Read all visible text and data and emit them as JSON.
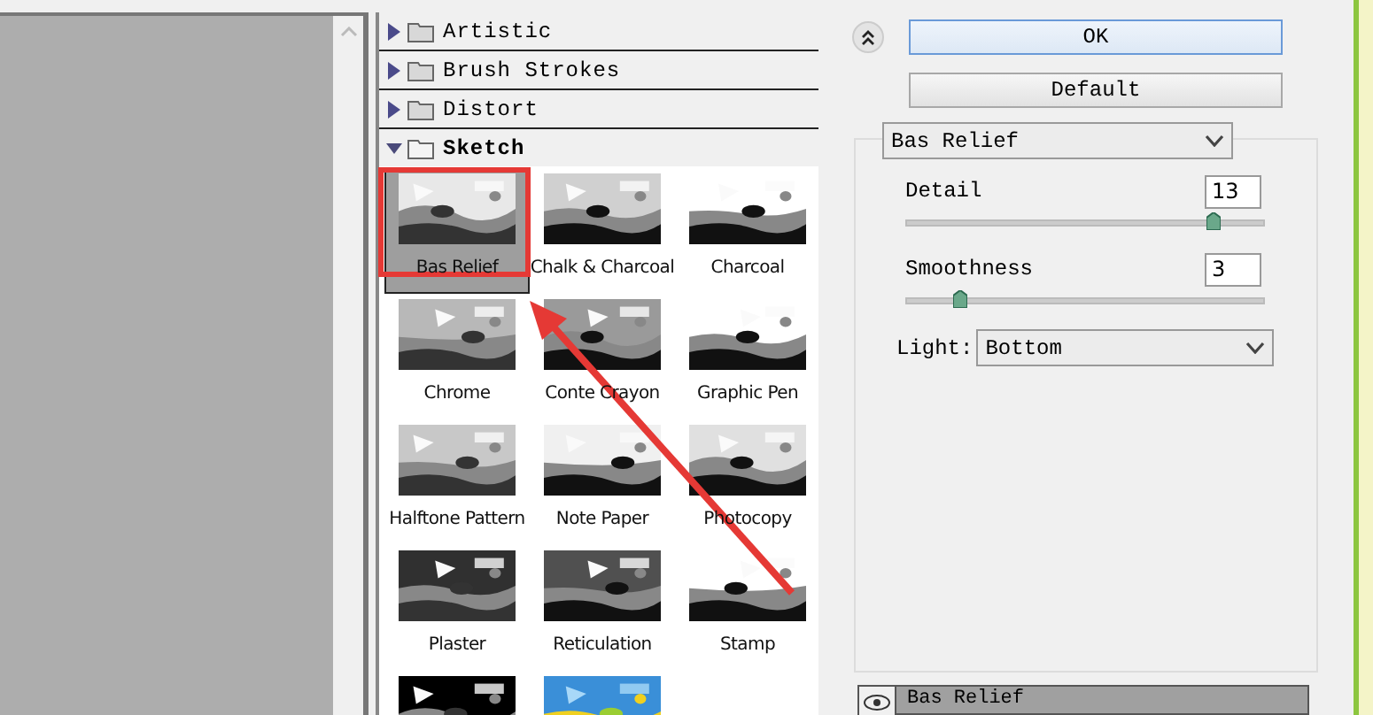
{
  "categories": [
    {
      "label": "Artistic",
      "expanded": false
    },
    {
      "label": "Brush Strokes",
      "expanded": false
    },
    {
      "label": "Distort",
      "expanded": false
    },
    {
      "label": "Sketch",
      "expanded": true
    }
  ],
  "thumbnails": [
    {
      "label": "Bas Relief",
      "selected": true
    },
    {
      "label": "Chalk & Charcoal",
      "selected": false
    },
    {
      "label": "Charcoal",
      "selected": false
    },
    {
      "label": "Chrome",
      "selected": false
    },
    {
      "label": "Conte Crayon",
      "selected": false
    },
    {
      "label": "Graphic Pen",
      "selected": false
    },
    {
      "label": "Halftone Pattern",
      "selected": false
    },
    {
      "label": "Note Paper",
      "selected": false
    },
    {
      "label": "Photocopy",
      "selected": false
    },
    {
      "label": "Plaster",
      "selected": false
    },
    {
      "label": "Reticulation",
      "selected": false
    },
    {
      "label": "Stamp",
      "selected": false
    },
    {
      "selected": false
    },
    {
      "selected": false
    }
  ],
  "buttons": [
    "OK",
    "Default"
  ],
  "filter_select": {
    "value": "Bas Relief"
  },
  "sliders": [
    {
      "label": "Detail",
      "value": "13",
      "level": 0.86
    },
    {
      "label": "Smoothness",
      "value": "3",
      "level": 0.15
    }
  ],
  "light": {
    "label": "Light:",
    "value": "Bottom"
  },
  "effect_layers": [
    {
      "label": "Bas Relief",
      "visible": true
    }
  ]
}
